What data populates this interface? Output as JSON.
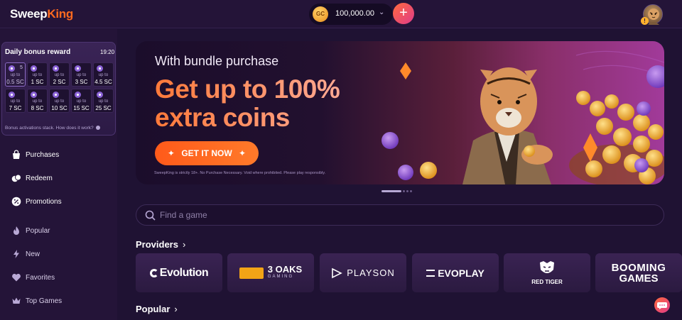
{
  "header": {
    "logo_sweep": "Sweep",
    "logo_king": "King",
    "coin_label": "GC",
    "balance": "100,000.00",
    "plus_label": "+",
    "avatar_alert": "!"
  },
  "bonus": {
    "title": "Daily bonus reward",
    "timer": "19:20",
    "footer": "Bonus activations stack. How does it work?",
    "cells": [
      {
        "count": "5",
        "upto": "up to",
        "amount": "0.5 SC"
      },
      {
        "count": "",
        "upto": "up to",
        "amount": "1 SC"
      },
      {
        "count": "",
        "upto": "up to",
        "amount": "2 SC"
      },
      {
        "count": "",
        "upto": "up to",
        "amount": "3 SC"
      },
      {
        "count": "",
        "upto": "up to",
        "amount": "4.5 SC"
      },
      {
        "count": "",
        "upto": "up to",
        "amount": "7 SC"
      },
      {
        "count": "",
        "upto": "up to",
        "amount": "8 SC"
      },
      {
        "count": "",
        "upto": "up to",
        "amount": "10 SC"
      },
      {
        "count": "",
        "upto": "up to",
        "amount": "15 SC"
      },
      {
        "count": "",
        "upto": "up to",
        "amount": "25 SC"
      }
    ]
  },
  "sidebar": {
    "items": [
      {
        "label": "Purchases"
      },
      {
        "label": "Redeem"
      },
      {
        "label": "Promotions"
      },
      {
        "label": "Popular"
      },
      {
        "label": "New"
      },
      {
        "label": "Favorites"
      },
      {
        "label": "Top Games"
      }
    ]
  },
  "hero": {
    "subtitle": "With bundle purchase",
    "title_line1": "Get up to 100%",
    "title_line2": "extra coins",
    "cta": "GET IT NOW",
    "disclaimer": "SweepKing is strictly 18+. No Purchase Necessary. Void where prohibited. Please play responsibly."
  },
  "search": {
    "placeholder": "Find a game"
  },
  "sections": {
    "providers": "Providers",
    "popular": "Popular",
    "chevron": "›"
  },
  "providers": [
    {
      "name": "Evolution"
    },
    {
      "name": "3 OAKS",
      "sub": "GAMING"
    },
    {
      "name": "PLAYSON"
    },
    {
      "name": "EVOPLAY"
    },
    {
      "name": "RED TIGER"
    },
    {
      "name": "BOOMING",
      "sub": "GAMES"
    }
  ],
  "colors": {
    "accent_orange": "#ff6a1f",
    "brand_purple": "#241438",
    "background": "#1f1233"
  }
}
